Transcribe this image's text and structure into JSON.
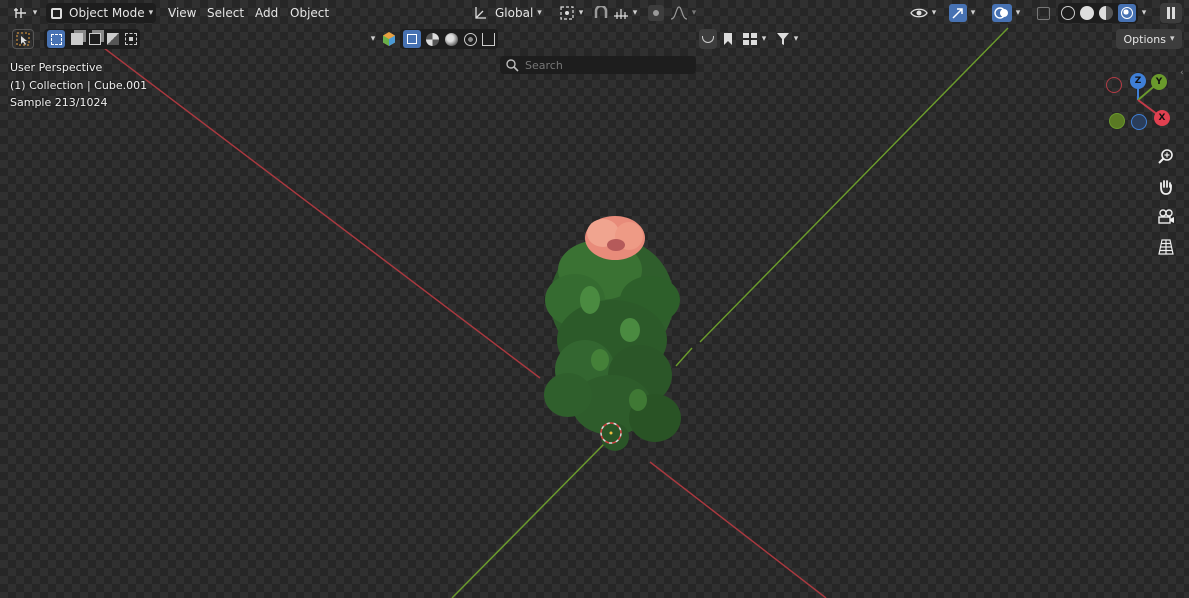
{
  "header": {
    "mode_label": "Object Mode",
    "menus": [
      "View",
      "Select",
      "Add",
      "Object"
    ],
    "transform_orientation": "Global",
    "options_label": "Options"
  },
  "search": {
    "placeholder": "Search"
  },
  "viewport_info": {
    "line1": "User Perspective",
    "line2": "(1) Collection | Cube.001",
    "line3": "Sample 213/1024"
  },
  "gizmo": {
    "x_label": "X",
    "y_label": "Y",
    "z_label": "Z"
  },
  "colors": {
    "x_axis": "#b23b45",
    "y_axis": "#6a9a2c",
    "z_axis": "#3f7fd6",
    "accent": "#4772b3"
  },
  "icons": [
    "editor-type-icon",
    "object-mode-icon",
    "transform-icon",
    "pivot-icon",
    "snap-icon",
    "proportional-icon",
    "select-box-icon",
    "visibility-icon",
    "gizmo-icon",
    "overlay-icon",
    "xray-icon",
    "wireframe-shading-icon",
    "solid-shading-icon",
    "material-shading-icon",
    "rendered-shading-icon",
    "zoom-icon",
    "hand-pan-icon",
    "camera-icon",
    "grid-view-icon"
  ]
}
